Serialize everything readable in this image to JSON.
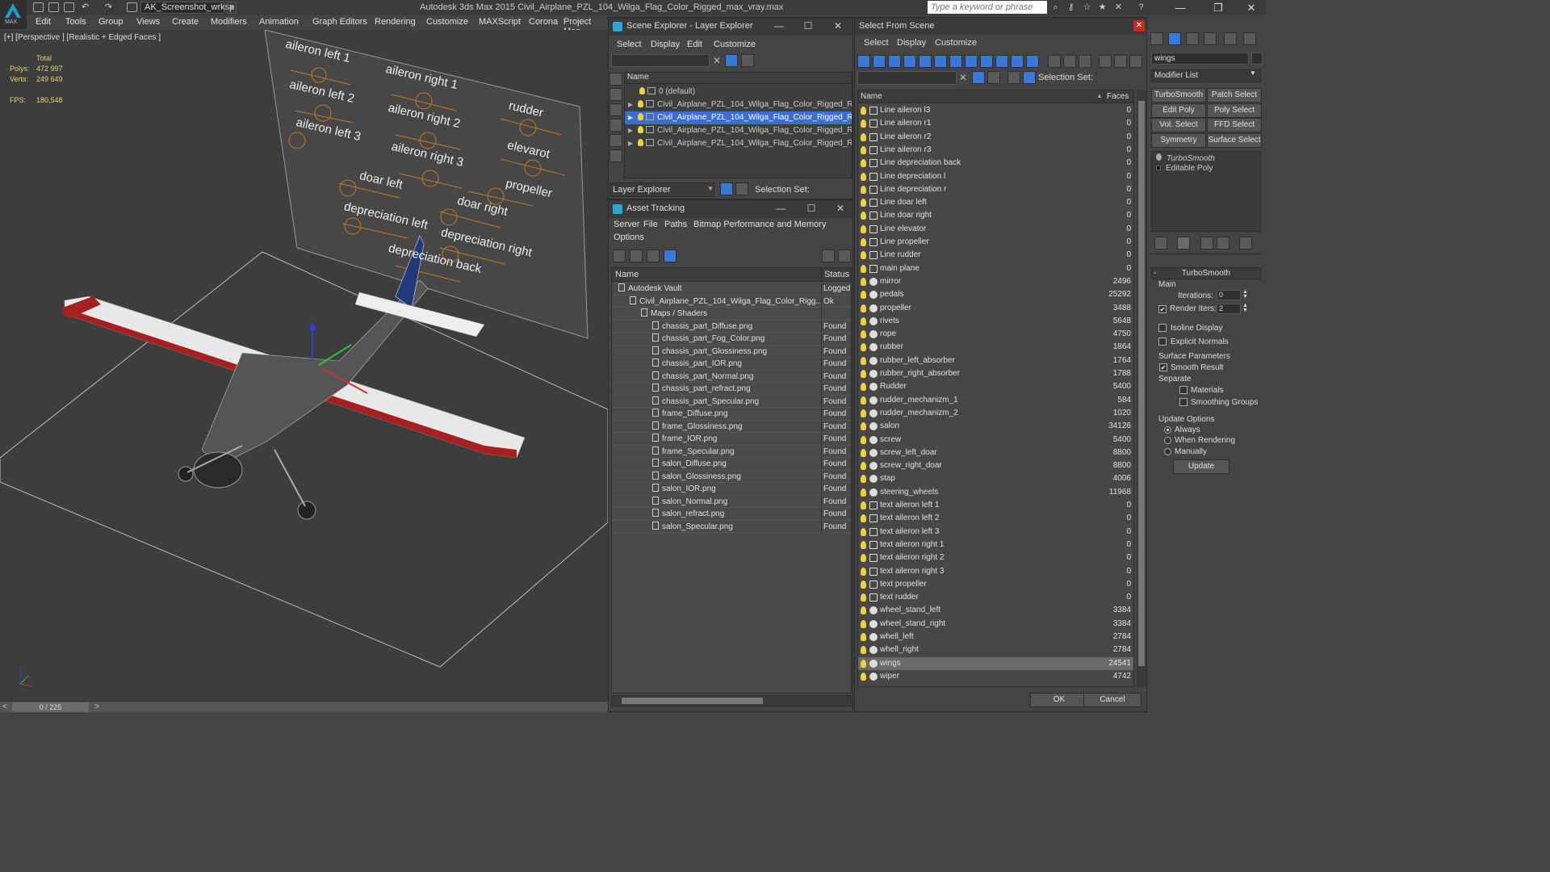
{
  "titlebar": {
    "workspace": "AK_Screenshot_wrksp",
    "app_title": "Autodesk 3ds Max  2015     Civil_Airplane_PZL_104_Wilga_Flag_Color_Rigged_max_vray.max",
    "search_placeholder": "Type a keyword or phrase",
    "logo_text": "MAX"
  },
  "menubar": [
    "Edit",
    "Tools",
    "Group",
    "Views",
    "Create",
    "Modifiers",
    "Animation",
    "Graph Editors",
    "Rendering",
    "Customize",
    "MAXScript",
    "Corona",
    "Project Man"
  ],
  "viewport": {
    "label": "[+] [Perspective ] [Realistic + Edged Faces ]",
    "stats": {
      "total_label": "Total",
      "polys_label": "Polys:",
      "polys": "472 997",
      "verts_label": "Verts:",
      "verts": "249 649",
      "fps_label": "FPS:",
      "fps": "180,548"
    },
    "board_labels": [
      "aileron left 1",
      "aileron right 1",
      "rudder",
      "aileron left 2",
      "aileron right 2",
      "elevarot",
      "aileron left 3",
      "aileron right 3",
      "propeller",
      "doar left",
      "doar right",
      "depreciation left",
      "depreciation right",
      "depreciation back"
    ]
  },
  "timeslider": {
    "frame": "0 / 225",
    "prev": "<",
    "next": ">"
  },
  "scene_explorer": {
    "title": "Scene Explorer - Layer Explorer",
    "menu": [
      "Select",
      "Display",
      "Edit",
      "Customize"
    ],
    "column": "Name",
    "rows": [
      {
        "label": "0 (default)"
      },
      {
        "label": "Civil_Airplane_PZL_104_Wilga_Flag_Color_Rigged_Rigge..."
      },
      {
        "label": "Civil_Airplane_PZL_104_Wilga_Flag_Color_Rigged_Rigged"
      },
      {
        "label": "Civil_Airplane_PZL_104_Wilga_Flag_Color_Rigged_Rigge..."
      },
      {
        "label": "Civil_Airplane_PZL_104_Wilga_Flag_Color_Rigged_Rigge..."
      }
    ],
    "footer_dropdown": "Layer Explorer",
    "selection_set_label": "Selection Set:"
  },
  "asset_tracking": {
    "title": "Asset Tracking",
    "menu": [
      "Server",
      "File",
      "Paths",
      "Bitmap Performance and Memory",
      "Options"
    ],
    "col_name": "Name",
    "col_status": "Status",
    "rows": [
      {
        "name": "Autodesk Vault",
        "status": "Logged",
        "indent": 1
      },
      {
        "name": "Civil_Airplane_PZL_104_Wilga_Flag_Color_Rigg...",
        "status": "Ok",
        "indent": 2
      },
      {
        "name": "Maps / Shaders",
        "status": "",
        "indent": 3
      },
      {
        "name": "chassis_part_Diffuse.png",
        "status": "Found",
        "indent": 4
      },
      {
        "name": "chassis_part_Fog_Color.png",
        "status": "Found",
        "indent": 4
      },
      {
        "name": "chassis_part_Glossiness.png",
        "status": "Found",
        "indent": 4
      },
      {
        "name": "chassis_part_IOR.png",
        "status": "Found",
        "indent": 4
      },
      {
        "name": "chassis_part_Normal.png",
        "status": "Found",
        "indent": 4
      },
      {
        "name": "chassis_part_refract.png",
        "status": "Found",
        "indent": 4
      },
      {
        "name": "chassis_part_Specular.png",
        "status": "Found",
        "indent": 4
      },
      {
        "name": "frame_Diffuse.png",
        "status": "Found",
        "indent": 4
      },
      {
        "name": "frame_Glossiness.png",
        "status": "Found",
        "indent": 4
      },
      {
        "name": "frame_IOR.png",
        "status": "Found",
        "indent": 4
      },
      {
        "name": "frame_Specular.png",
        "status": "Found",
        "indent": 4
      },
      {
        "name": "salon_Diffuse.png",
        "status": "Found",
        "indent": 4
      },
      {
        "name": "salon_Glossiness.png",
        "status": "Found",
        "indent": 4
      },
      {
        "name": "salon_IOR.png",
        "status": "Found",
        "indent": 4
      },
      {
        "name": "salon_Normal.png",
        "status": "Found",
        "indent": 4
      },
      {
        "name": "salon_refract.png",
        "status": "Found",
        "indent": 4
      },
      {
        "name": "salon_Specular.png",
        "status": "Found",
        "indent": 4
      }
    ]
  },
  "select_from_scene": {
    "title": "Select From Scene",
    "menu": [
      "Select",
      "Display",
      "Customize"
    ],
    "selection_set_label": "Selection Set:",
    "col_name": "Name",
    "col_faces": "Faces",
    "ok": "OK",
    "cancel": "Cancel",
    "rows": [
      {
        "name": "Line aileron l3",
        "faces": "0",
        "shape": true
      },
      {
        "name": "Line aileron r1",
        "faces": "0",
        "shape": true
      },
      {
        "name": "Line aileron r2",
        "faces": "0",
        "shape": true
      },
      {
        "name": "Line aileron r3",
        "faces": "0",
        "shape": true
      },
      {
        "name": "Line depreciation back",
        "faces": "0",
        "shape": true
      },
      {
        "name": "Line depreciation l",
        "faces": "0",
        "shape": true
      },
      {
        "name": "Line depreciation r",
        "faces": "0",
        "shape": true
      },
      {
        "name": "Line doar left",
        "faces": "0",
        "shape": true
      },
      {
        "name": "Line doar right",
        "faces": "0",
        "shape": true
      },
      {
        "name": "Line elevator",
        "faces": "0",
        "shape": true
      },
      {
        "name": "Line propeller",
        "faces": "0",
        "shape": true
      },
      {
        "name": "Line rudder",
        "faces": "0",
        "shape": true
      },
      {
        "name": "main plane",
        "faces": "0",
        "shape": true
      },
      {
        "name": "mirror",
        "faces": "2496",
        "shape": false
      },
      {
        "name": "pedals",
        "faces": "25292",
        "shape": false
      },
      {
        "name": "propeller",
        "faces": "3488",
        "shape": false
      },
      {
        "name": "rivets",
        "faces": "5648",
        "shape": false
      },
      {
        "name": "rope",
        "faces": "4750",
        "shape": false
      },
      {
        "name": "rubber",
        "faces": "1864",
        "shape": false
      },
      {
        "name": "rubber_left_absorber",
        "faces": "1764",
        "shape": false
      },
      {
        "name": "rubber_right_absorber",
        "faces": "1788",
        "shape": false
      },
      {
        "name": "Rudder",
        "faces": "5400",
        "shape": false
      },
      {
        "name": "rudder_mechanizm_1",
        "faces": "584",
        "shape": false
      },
      {
        "name": "rudder_mechanizm_2",
        "faces": "1020",
        "shape": false
      },
      {
        "name": "salon",
        "faces": "34126",
        "shape": false
      },
      {
        "name": "screw",
        "faces": "5400",
        "shape": false
      },
      {
        "name": "screw_left_doar",
        "faces": "8800",
        "shape": false
      },
      {
        "name": "screw_right_doar",
        "faces": "8800",
        "shape": false
      },
      {
        "name": "stap",
        "faces": "4006",
        "shape": false
      },
      {
        "name": "steering_wheels",
        "faces": "11968",
        "shape": false
      },
      {
        "name": "text aileron left 1",
        "faces": "0",
        "shape": true
      },
      {
        "name": "text aileron left 2",
        "faces": "0",
        "shape": true
      },
      {
        "name": "text aileron left 3",
        "faces": "0",
        "shape": true
      },
      {
        "name": "text aileron right 1",
        "faces": "0",
        "shape": true
      },
      {
        "name": "text aileron right 2",
        "faces": "0",
        "shape": true
      },
      {
        "name": "text aileron right 3",
        "faces": "0",
        "shape": true
      },
      {
        "name": "text propeller",
        "faces": "0",
        "shape": true
      },
      {
        "name": "text rudder",
        "faces": "0",
        "shape": true
      },
      {
        "name": "wheel_stand_left",
        "faces": "3384",
        "shape": false
      },
      {
        "name": "wheel_stand_right",
        "faces": "3384",
        "shape": false
      },
      {
        "name": "whell_left",
        "faces": "2784",
        "shape": false
      },
      {
        "name": "whell_right",
        "faces": "2784",
        "shape": false
      },
      {
        "name": "wings",
        "faces": "24541",
        "shape": false,
        "selected": true
      },
      {
        "name": "wiper",
        "faces": "4742",
        "shape": false
      }
    ]
  },
  "command_panel": {
    "object_name": "wings",
    "modifier_list": "Modifier List",
    "mod_buttons": [
      "TurboSmooth",
      "Patch Select",
      "Edit Poly",
      "Poly Select",
      "Vol. Select",
      "FFD Select",
      "Symmetry",
      "Surface Select"
    ],
    "stack": [
      "TurboSmooth",
      "Editable Poly"
    ],
    "rollout_title": "TurboSmooth",
    "main_label": "Main",
    "iterations_label": "Iterations:",
    "iterations": "0",
    "render_iters_label": "Render Iters:",
    "render_iters": "2",
    "isoline": "Isoline Display",
    "explicit_normals": "Explicit Normals",
    "surface_params": "Surface Parameters",
    "smooth_result": "Smooth Result",
    "separate": "Separate",
    "materials": "Materials",
    "smoothing_groups": "Smoothing Groups",
    "update_options": "Update Options",
    "always": "Always",
    "when_rendering": "When Rendering",
    "manually": "Manually",
    "update_btn": "Update"
  }
}
